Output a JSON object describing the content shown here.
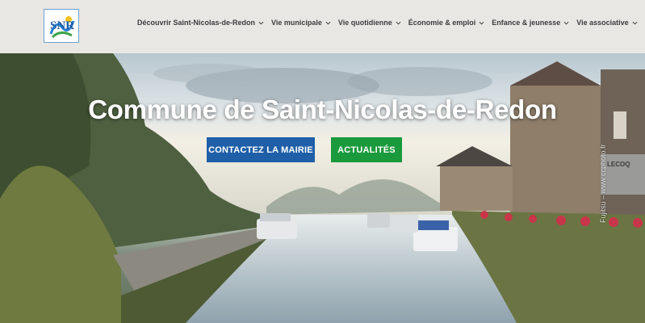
{
  "header": {
    "logo_text": "SNR",
    "nav": [
      {
        "label": "Découvrir Saint-Nicolas-de-Redon"
      },
      {
        "label": "Vie municipale"
      },
      {
        "label": "Vie quotidienne"
      },
      {
        "label": "Économie & emploi"
      },
      {
        "label": "Enfance & jeunesse"
      },
      {
        "label": "Vie associative"
      }
    ]
  },
  "hero": {
    "title": "Commune de Saint-Nicolas-de-Redon",
    "contact_button": "CONTACTEZ LA MAIRIE",
    "news_button": "ACTUALITÉS",
    "photo_credit": "Fujitsu – www.ccphoto.fr",
    "sign_text": "LECOQ"
  },
  "colors": {
    "header_bg": "#e9e7e4",
    "contact_button": "#1f5fa8",
    "news_button": "#1a9a3c"
  }
}
